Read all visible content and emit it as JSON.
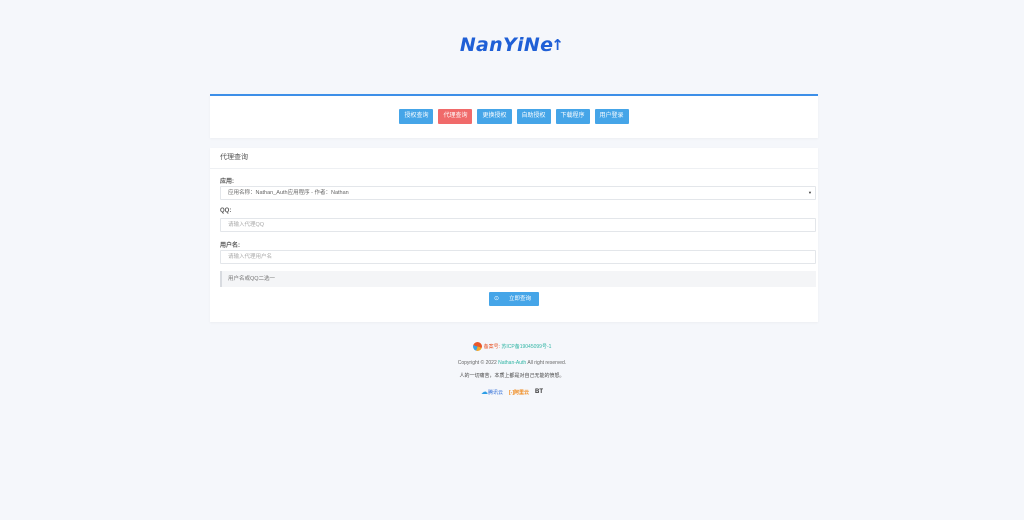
{
  "logo": {
    "text": "NanYiNe",
    "arrow": "↑"
  },
  "nav": {
    "buttons": [
      {
        "label": "授权查询"
      },
      {
        "label": "代理查询"
      },
      {
        "label": "更换授权"
      },
      {
        "label": "自助授权"
      },
      {
        "label": "下载程序"
      },
      {
        "label": "用户登录"
      }
    ],
    "active_index": 1
  },
  "form": {
    "title": "代理查询",
    "app_label": "应用:",
    "app_value": "应用名称：Nathan_Auth应用程序 - 作者：Nathan",
    "qq_label": "QQ:",
    "qq_placeholder": "请输入代理QQ",
    "user_label": "用户名:",
    "user_placeholder": "请输入代理用户名",
    "hint": "用户名或QQ二选一",
    "submit_label": "立即查询"
  },
  "footer": {
    "icp_label": "备案号:",
    "icp_number": "苏ICP备19045099号-1",
    "copyright_prefix": "Copyright © 2022",
    "copyright_link": "Nathan-Auth",
    "copyright_suffix": "All right reserved.",
    "slogan": "人的一切痛苦，本质上都是对自己无能的愤怒。",
    "partners": [
      "腾讯云",
      "阿里云",
      "BT"
    ]
  },
  "colors": {
    "accent": "#45a5e8",
    "active": "#f06a6a",
    "link": "#2fb5a4",
    "top_border": "#3d8fe8"
  }
}
